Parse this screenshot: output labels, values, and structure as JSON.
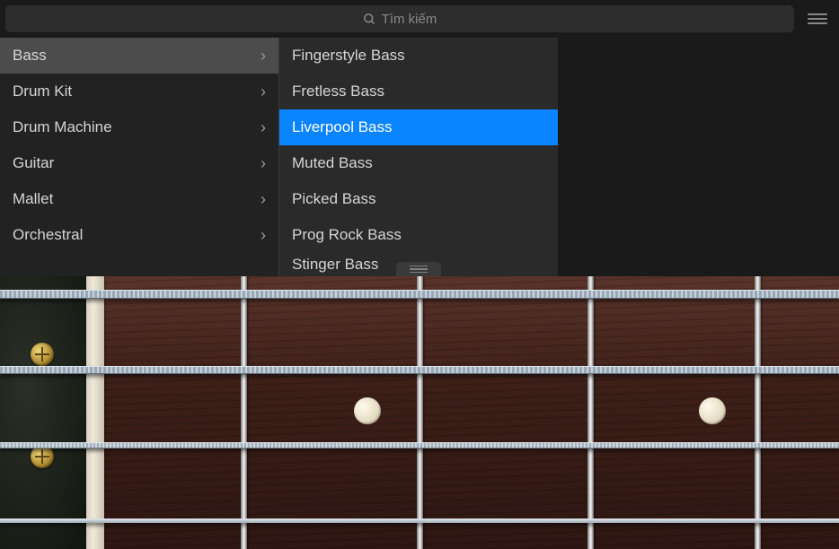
{
  "search": {
    "placeholder": "Tìm kiếm"
  },
  "categories": [
    {
      "label": "Bass",
      "selected": true
    },
    {
      "label": "Drum Kit",
      "selected": false
    },
    {
      "label": "Drum Machine",
      "selected": false
    },
    {
      "label": "Guitar",
      "selected": false
    },
    {
      "label": "Mallet",
      "selected": false
    },
    {
      "label": "Orchestral",
      "selected": false
    }
  ],
  "sub_instruments": [
    {
      "label": "Fingerstyle Bass",
      "selected": false
    },
    {
      "label": "Fretless Bass",
      "selected": false
    },
    {
      "label": "Liverpool Bass",
      "selected": true
    },
    {
      "label": "Muted Bass",
      "selected": false
    },
    {
      "label": "Picked Bass",
      "selected": false
    },
    {
      "label": "Prog Rock Bass",
      "selected": false
    },
    {
      "label": "Stinger Bass",
      "selected": false
    }
  ],
  "colors": {
    "selection": "#0a84ff"
  }
}
